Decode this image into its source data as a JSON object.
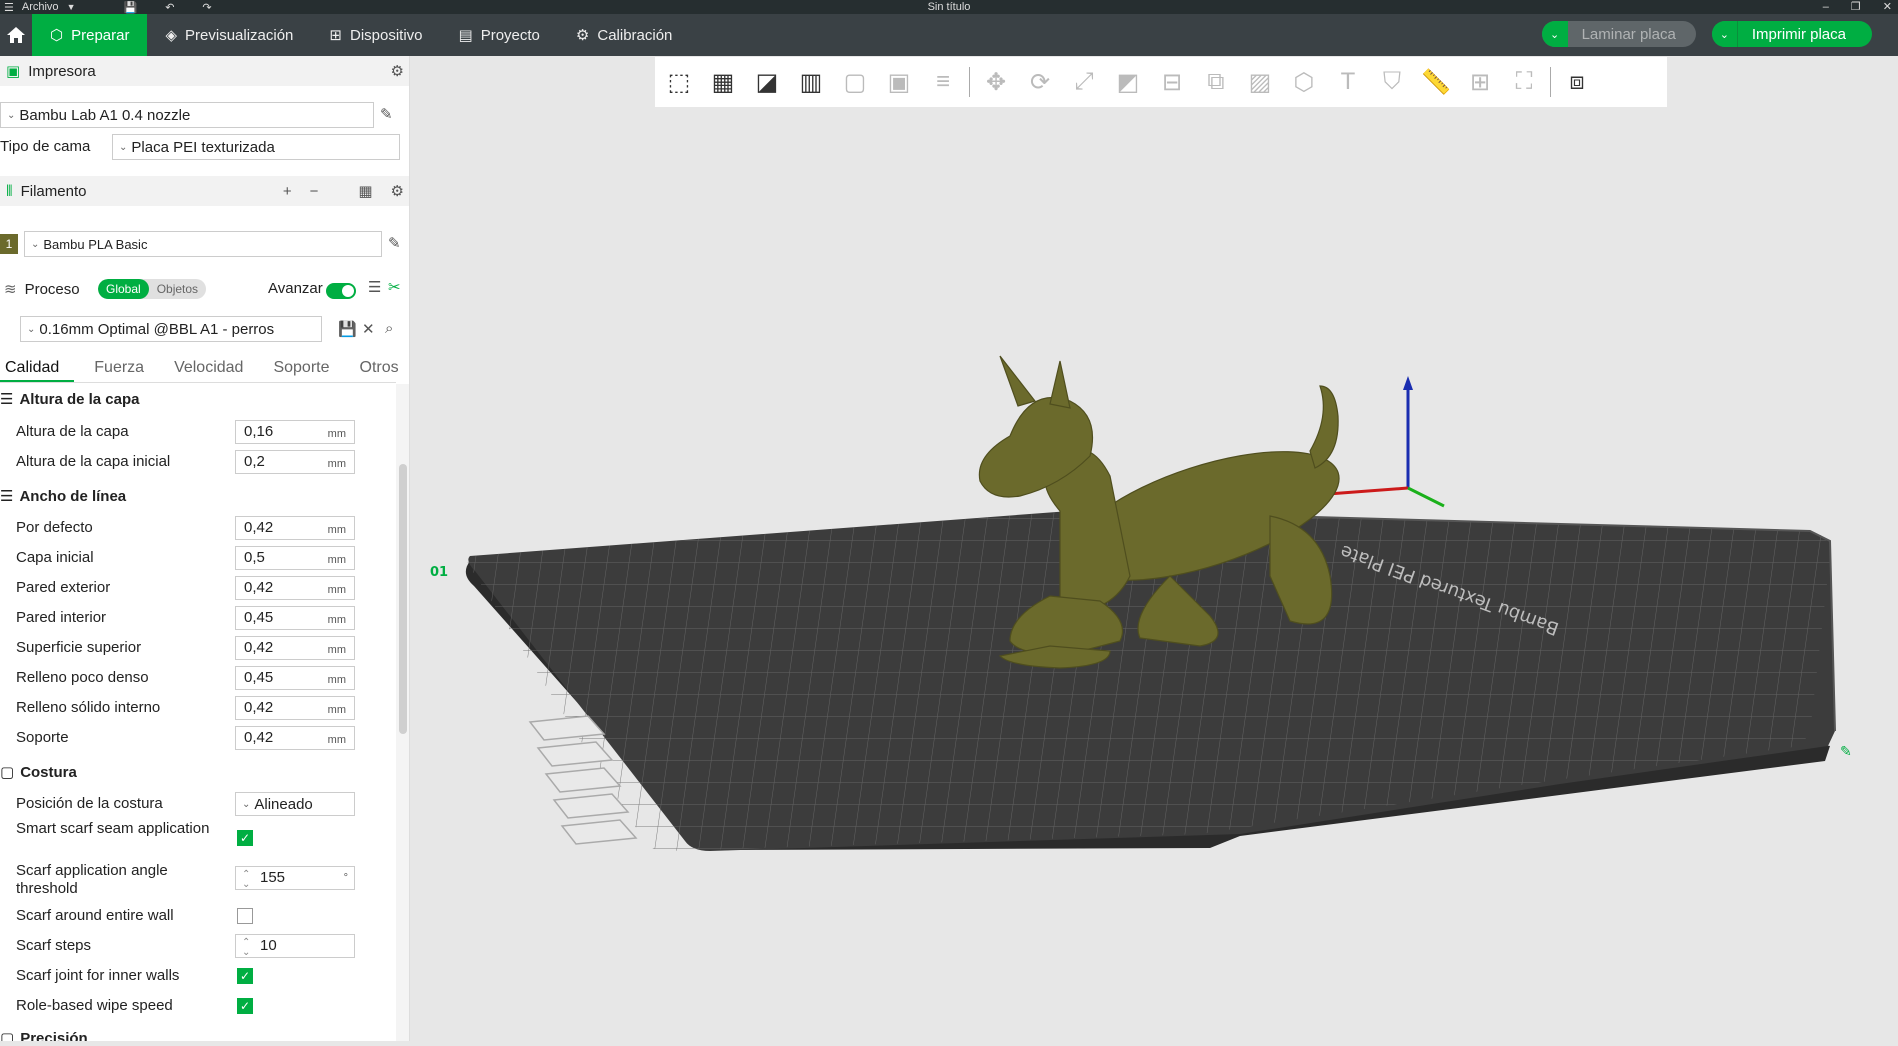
{
  "titlebar": {
    "menu_label": "Archivo",
    "title": "Sin título"
  },
  "menubar": {
    "tabs": [
      {
        "label": "Preparar"
      },
      {
        "label": "Previsualización"
      },
      {
        "label": "Dispositivo"
      },
      {
        "label": "Proyecto"
      },
      {
        "label": "Calibración"
      }
    ],
    "slice_label": "Laminar placa",
    "print_label": "Imprimir placa"
  },
  "printer": {
    "section_title": "Impresora",
    "printer_name": "Bambu Lab A1 0.4 nozzle",
    "bed_type_label": "Tipo de cama",
    "bed_type_value": "Placa PEI texturizada"
  },
  "filament": {
    "section_title": "Filamento",
    "slot_number": "1",
    "filament_name": "Bambu PLA Basic"
  },
  "process": {
    "section_title": "Proceso",
    "seg_global": "Global",
    "seg_objects": "Objetos",
    "advanced_label": "Avanzar",
    "profile_name": "0.16mm Optimal @BBL A1 - perros",
    "tabs": [
      "Calidad",
      "Fuerza",
      "Velocidad",
      "Soporte",
      "Otros"
    ]
  },
  "settings": {
    "layer_height_group": "Altura de la capa",
    "layer_height": {
      "label": "Altura de la capa",
      "value": "0,16",
      "unit": "mm"
    },
    "initial_layer_height": {
      "label": "Altura de la capa inicial",
      "value": "0,2",
      "unit": "mm"
    },
    "line_width_group": "Ancho de línea",
    "line_widths": [
      {
        "label": "Por defecto",
        "value": "0,42",
        "unit": "mm"
      },
      {
        "label": "Capa inicial",
        "value": "0,5",
        "unit": "mm"
      },
      {
        "label": "Pared exterior",
        "value": "0,42",
        "unit": "mm"
      },
      {
        "label": "Pared interior",
        "value": "0,45",
        "unit": "mm"
      },
      {
        "label": "Superficie superior",
        "value": "0,42",
        "unit": "mm"
      },
      {
        "label": "Relleno poco denso",
        "value": "0,45",
        "unit": "mm"
      },
      {
        "label": "Relleno sólido interno",
        "value": "0,42",
        "unit": "mm"
      },
      {
        "label": "Soporte",
        "value": "0,42",
        "unit": "mm"
      }
    ],
    "seam_group": "Costura",
    "seam_position": {
      "label": "Posición de la costura",
      "value": "Alineado"
    },
    "smart_scarf": {
      "label": "Smart scarf seam application",
      "checked": true
    },
    "scarf_angle": {
      "label": "Scarf application angle threshold",
      "value": "155",
      "unit": "°"
    },
    "scarf_entire_wall": {
      "label": "Scarf around entire wall",
      "checked": false
    },
    "scarf_steps": {
      "label": "Scarf steps",
      "value": "10"
    },
    "scarf_inner": {
      "label": "Scarf joint for inner walls",
      "checked": true
    },
    "role_wipe": {
      "label": "Role-based wipe speed",
      "checked": true
    },
    "next_group": "Precisión"
  },
  "viewport": {
    "plate_number": "01",
    "plate_brand": "Bambu Textured PEI Plate",
    "model_color": "#6b6a2c",
    "accent": "#00ae42"
  }
}
